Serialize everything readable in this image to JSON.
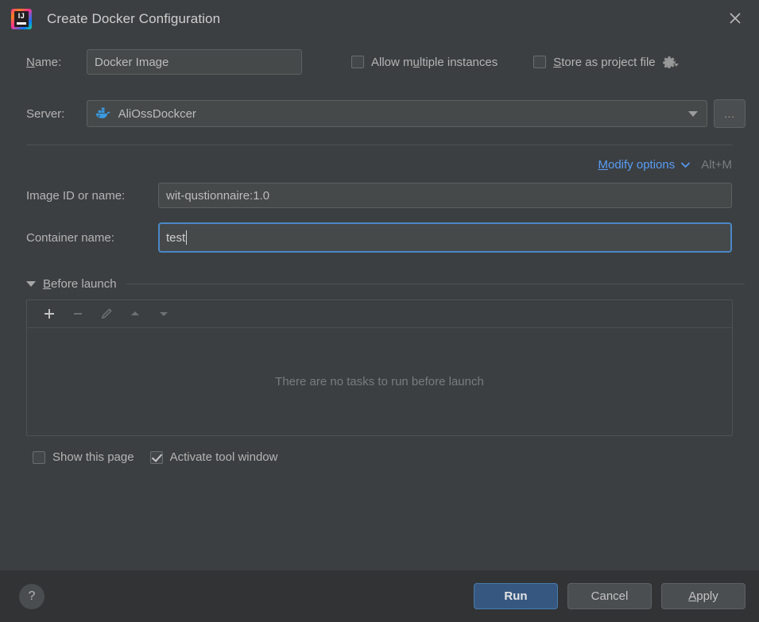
{
  "window": {
    "title": "Create Docker Configuration",
    "app_icon": "intellij-idea-logo",
    "close_icon": "close-icon"
  },
  "name_row": {
    "label": "Name:",
    "label_mnemonic": "N",
    "value": "Docker Image",
    "allow_multiple": {
      "label": "Allow multiple instances",
      "mnemonic": "u",
      "checked": false
    },
    "store_as_project_file": {
      "label": "Store as project file",
      "mnemonic": "S",
      "checked": false,
      "gear_icon": "gear-icon"
    }
  },
  "server_row": {
    "label": "Server:",
    "value": "AliOssDockcer",
    "icon": "docker-whale-icon",
    "dropdown_icon": "chevron-down-icon",
    "browse_button": "..."
  },
  "modify_options": {
    "label": "Modify options",
    "mnemonic": "M",
    "chevron_icon": "chevron-down-icon",
    "shortcut": "Alt+M"
  },
  "fields": [
    {
      "label": "Image ID or name:",
      "value": "wit-qustionnaire:1.0",
      "focused": false
    },
    {
      "label": "Container name:",
      "value": "test",
      "focused": true
    }
  ],
  "before_launch": {
    "title": "Before launch",
    "mnemonic": "B",
    "expanded": true,
    "collapse_icon": "triangle-down-icon",
    "toolbar": [
      {
        "name": "add-task-button",
        "icon": "plus-icon",
        "enabled": true
      },
      {
        "name": "remove-task-button",
        "icon": "minus-icon",
        "enabled": false
      },
      {
        "name": "edit-task-button",
        "icon": "pencil-icon",
        "enabled": false
      },
      {
        "name": "move-task-up-button",
        "icon": "arrow-up-icon",
        "enabled": false
      },
      {
        "name": "move-task-down-button",
        "icon": "arrow-down-icon",
        "enabled": false
      }
    ],
    "empty_text": "There are no tasks to run before launch",
    "tasks": []
  },
  "options": {
    "show_this_page": {
      "label": "Show this page",
      "checked": false
    },
    "activate_tool_window": {
      "label": "Activate tool window",
      "checked": true
    }
  },
  "footer": {
    "help_label": "?",
    "run": "Run",
    "cancel": "Cancel",
    "apply": "Apply",
    "apply_mnemonic": "A"
  },
  "colors": {
    "background": "#3c3f41",
    "footer_background": "#313335",
    "accent_link": "#589df6",
    "primary_button": "#365880",
    "focus_border": "#4a88c7",
    "docker_blue": "#3a9ae0"
  }
}
